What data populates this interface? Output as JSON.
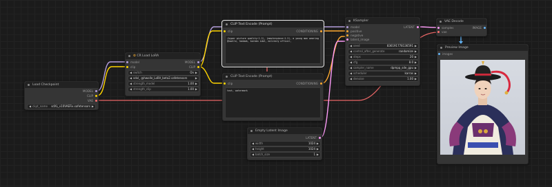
{
  "nodes": {
    "load_checkpoint": {
      "title": "Load Checkpoint",
      "outputs": [
        "MODEL",
        "CLIP",
        "VAE"
      ],
      "ckpt_name_label": "ckpt_name",
      "ckpt_name_value": "sdXL_v10VAEFix.safetensors"
    },
    "cr_load_lora": {
      "title": "CR Load LoRA",
      "inputs": [
        "model",
        "clip"
      ],
      "outputs": [
        "MODEL",
        "CLIP"
      ],
      "widgets": [
        {
          "label": "switch",
          "value": "On"
        },
        {
          "label": "",
          "value": "sdxl_ @hwolle_LoRA_beta2.safetensors"
        },
        {
          "label": "strength_model",
          "value": "1.00"
        },
        {
          "label": "strength_clip",
          "value": "1.00"
        }
      ]
    },
    "clip_pos": {
      "title": "CLIP Text Encode (Prompt)",
      "input": "clip",
      "output": "CONDITIONING",
      "text": "(hyper picture quality:1.2), (masterpiece:1.2), a young man wearing @hwolle, hanbok, korean idol, military officer,"
    },
    "clip_neg": {
      "title": "CLIP Text Encode (Prompt)",
      "input": "clip",
      "output": "CONDITIONING",
      "text": "text, watermark"
    },
    "empty_latent": {
      "title": "Empty Latent Image",
      "output": "LATENT",
      "widgets": [
        {
          "label": "width",
          "value": "1024"
        },
        {
          "label": "height",
          "value": "1024"
        },
        {
          "label": "batch_size",
          "value": "1"
        }
      ]
    },
    "ksampler": {
      "title": "KSampler",
      "inputs": [
        "model",
        "positive",
        "negative",
        "latent_image"
      ],
      "output": "LATENT",
      "widgets": [
        {
          "label": "seed",
          "value": "836191778136591"
        },
        {
          "label": "control_after_generate",
          "value": "randomize"
        },
        {
          "label": "steps",
          "value": "20"
        },
        {
          "label": "cfg",
          "value": "8.0"
        },
        {
          "label": "sampler_name",
          "value": "dpmpp_sde_gpu"
        },
        {
          "label": "scheduler",
          "value": "karras"
        },
        {
          "label": "denoise",
          "value": "1.00"
        }
      ]
    },
    "vae_decode": {
      "title": "VAE Decode",
      "inputs": [
        "samples",
        "vae"
      ],
      "output": "IMAGE"
    },
    "preview_image": {
      "title": "Preview Image",
      "input": "images"
    }
  },
  "colors": {
    "model": "#b39ddb",
    "clip": "#ffd500",
    "vae": "#ff6e6e",
    "conditioning": "#ffa931",
    "latent": "#ff9cf9",
    "image": "#64b5f6"
  }
}
